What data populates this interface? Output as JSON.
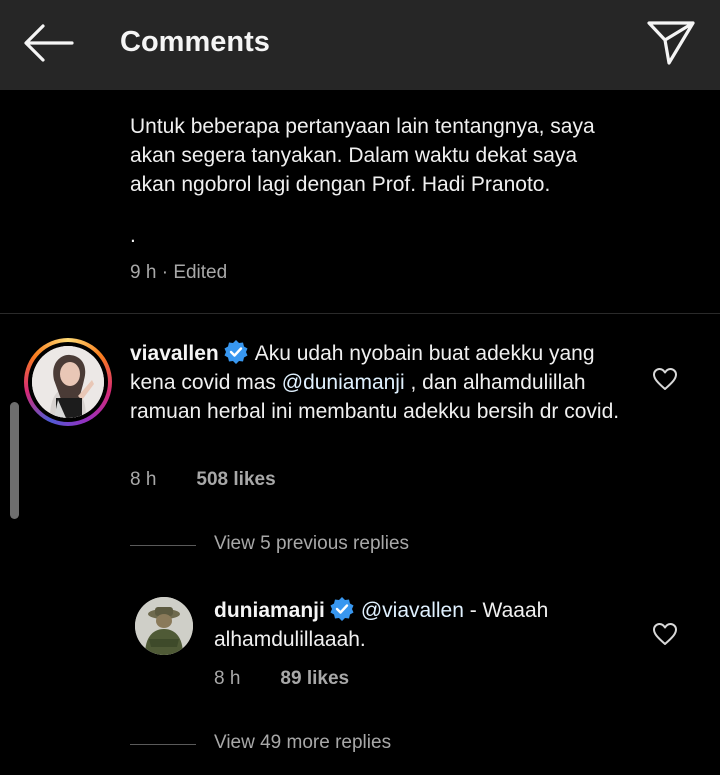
{
  "header": {
    "title": "Comments",
    "back_icon": "arrow-left-icon",
    "send_icon": "paper-plane-icon"
  },
  "previous_comment": {
    "text": "Untuk beberapa pertanyaan lain tentangnya, saya\nakan segera tanyakan. Dalam waktu dekat saya\nakan ngobrol lagi dengan Prof. Hadi Pranoto.",
    "trailing": ".",
    "time": "9 h",
    "separator": " · ",
    "edited": "Edited"
  },
  "comment": {
    "username": "viavallen",
    "text_before_mention": "Aku udah nyobain buat adekku yang kena covid mas ",
    "mention": "@duniamanji",
    "text_after_mention": " , dan alhamdulillah ramuan herbal ini membantu adekku bersih dr covid.",
    "time": "8 h",
    "likes": "508 likes"
  },
  "view_previous_replies": "View 5 previous replies",
  "reply": {
    "username": "duniamanji",
    "mention": "@viavallen",
    "text": " - Waaah alhamdulillaaah.",
    "time": "8 h",
    "likes": "89 likes"
  },
  "view_more_replies": "View 49 more replies",
  "colors": {
    "background": "#000000",
    "header": "#262626",
    "text": "#f0f0f0",
    "secondary": "#a8a8a8",
    "verified": "#3897f0",
    "mention": "#e0f1ff"
  }
}
